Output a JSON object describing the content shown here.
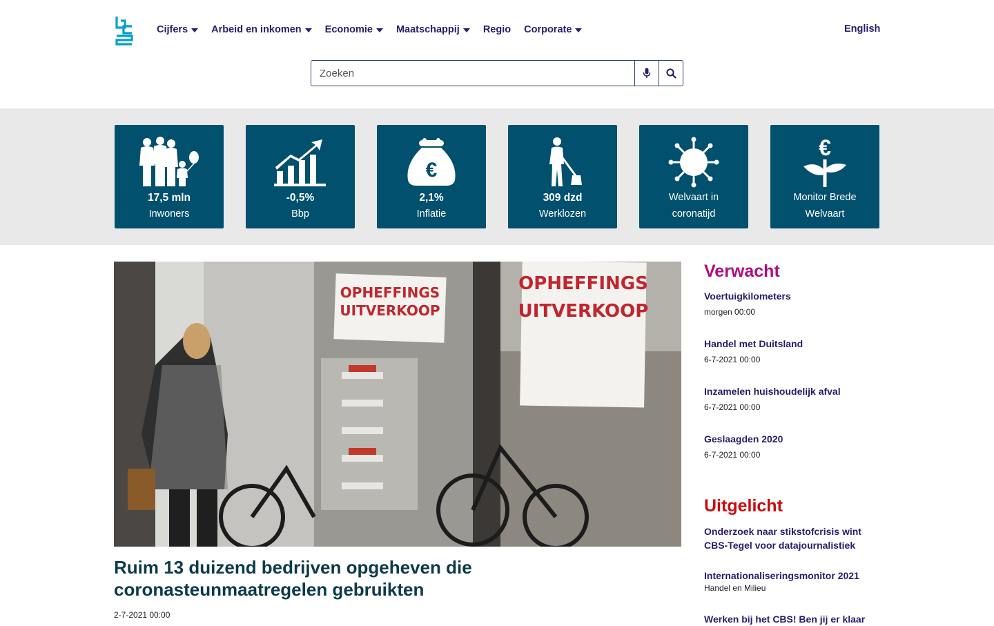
{
  "nav": {
    "items": [
      {
        "label": "Cijfers",
        "dropdown": true
      },
      {
        "label": "Arbeid en inkomen",
        "dropdown": true
      },
      {
        "label": "Economie",
        "dropdown": true
      },
      {
        "label": "Maatschappij",
        "dropdown": true
      },
      {
        "label": "Regio",
        "dropdown": false
      },
      {
        "label": "Corporate",
        "dropdown": true
      }
    ],
    "language": "English"
  },
  "search": {
    "placeholder": "Zoeken",
    "icons": [
      "microphone-icon",
      "search-icon"
    ]
  },
  "tiles": [
    {
      "icon": "family-icon",
      "value": "17,5 mln",
      "label": "Inwoners"
    },
    {
      "icon": "growth-chart-icon",
      "value": "-0,5%",
      "label": "Bbp"
    },
    {
      "icon": "euro-purse-icon",
      "value": "2,1%",
      "label": "Inflatie"
    },
    {
      "icon": "worker-shovel-icon",
      "value": "309 dzd",
      "label": "Werklozen"
    },
    {
      "icon": "virus-icon",
      "line1": "Welvaart in",
      "line2": "coronatijd"
    },
    {
      "icon": "euro-plant-icon",
      "line1": "Monitor Brede",
      "line2": "Welvaart"
    }
  ],
  "headline": {
    "title": "Ruim 13 duizend bedrijven opgeheven die coronasteunmaatregelen gebruikten",
    "date": "2-7-2021 00:00",
    "image_signs": [
      "OPHEFFINGS",
      "UITVERKOOP"
    ]
  },
  "verwacht": {
    "title": "Verwacht",
    "color": "#af0e80",
    "items": [
      {
        "title": "Voertuigkilometers",
        "date": "morgen 00:00"
      },
      {
        "title": "Handel met Duitsland",
        "date": "6-7-2021 00:00"
      },
      {
        "title": "Inzamelen huishoudelijk afval",
        "date": "6-7-2021 00:00"
      },
      {
        "title": "Geslaagden 2020",
        "date": "6-7-2021 00:00"
      }
    ]
  },
  "uitgelicht": {
    "title": "Uitgelicht",
    "color": "#c90c0f",
    "items": [
      {
        "title": "Onderzoek naar stikstofcrisis wint CBS-Tegel voor datajournalistiek",
        "sub": ""
      },
      {
        "title": "Internationaliseringsmonitor 2021",
        "sub": "Handel en Milieu"
      },
      {
        "title": "Werken bij het CBS! Ben jij er klaar",
        "sub": ""
      }
    ]
  },
  "colors": {
    "tile": "#00506e",
    "band": "#e9e9e9",
    "nav_text": "#271d6c",
    "logo": "#00a1cd"
  }
}
